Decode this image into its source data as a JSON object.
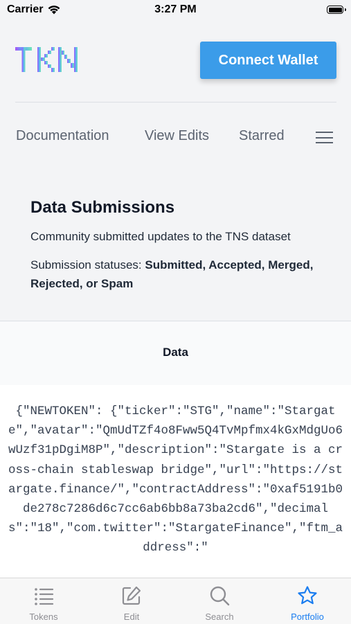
{
  "status_bar": {
    "carrier": "Carrier",
    "time": "3:27 PM"
  },
  "header": {
    "logo_text": "TKN",
    "connect_label": "Connect Wallet"
  },
  "nav": {
    "items": [
      "Documentation",
      "View Edits",
      "Starred"
    ],
    "menu_icon": "hamburger-icon"
  },
  "page": {
    "title": "Data Submissions",
    "subtitle": "Community submitted updates to the TNS dataset",
    "statuses_prefix": "Submission statuses: ",
    "statuses_values": "Submitted, Accepted, Merged, Rejected, or Spam"
  },
  "table": {
    "header": "Data",
    "rows": [
      "{\"NEWTOKEN\": {\"ticker\":\"STG\",\"name\":\"Stargate\",\"avatar\":\"QmUdTZf4o8Fww5Q4TvMpfmx4kGxMdgUo6wUzf31pDgiM8P\",\"description\":\"Stargate is a cross-chain stableswap bridge\",\"url\":\"https://stargate.finance/\",\"contractAddress\":\"0xaf5191b0de278c7286d6c7cc6ab6bb8a73ba2cd6\",\"decimals\":\"18\",\"com.twitter\":\"StargateFinance\",\"ftm_address\":\""
    ]
  },
  "tabbar": {
    "tabs": [
      {
        "label": "Tokens",
        "icon": "list-icon"
      },
      {
        "label": "Edit",
        "icon": "edit-icon"
      },
      {
        "label": "Search",
        "icon": "search-icon"
      },
      {
        "label": "Portfolio",
        "icon": "star-icon"
      }
    ],
    "active_index": 3
  },
  "colors": {
    "accent": "#3b9ce9",
    "tab_active": "#1a7df0",
    "tab_inactive": "#8e8e93"
  }
}
